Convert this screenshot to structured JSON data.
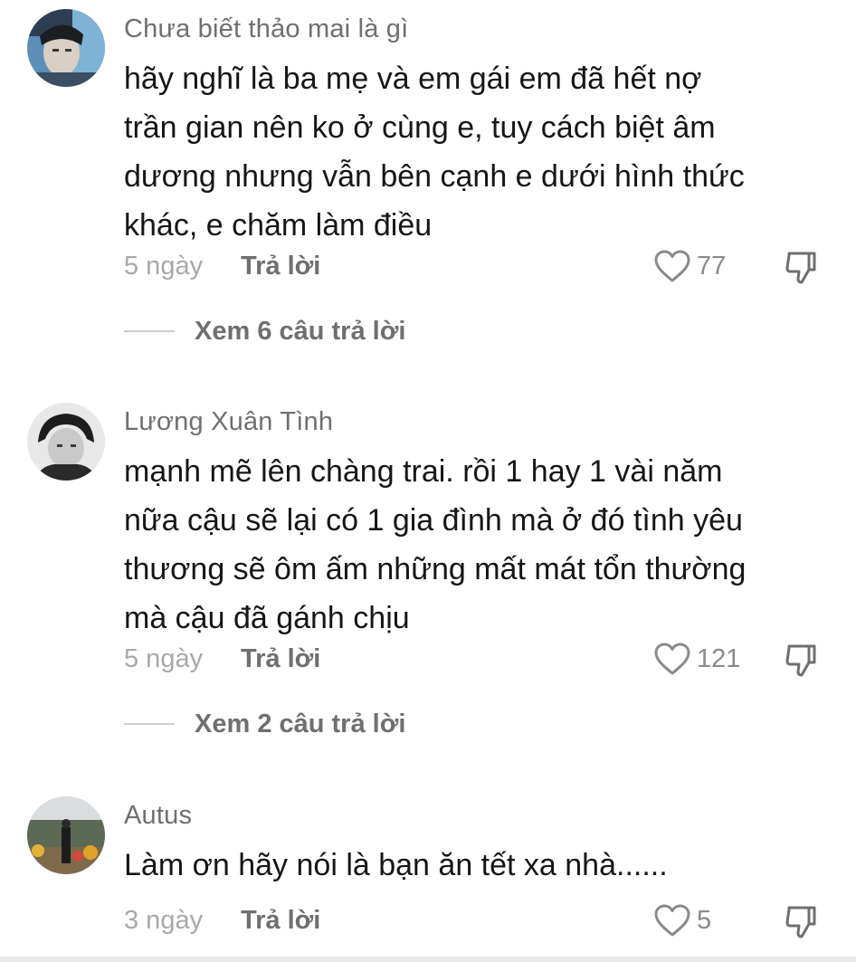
{
  "comments": [
    {
      "username": "Chưa biết thảo mai là gì",
      "lines": [
        "hãy nghĩ là ba mẹ và em gái em đã hết nợ",
        "trần gian nên ko ở cùng e, tuy cách biệt âm",
        "dương nhưng vẫn bên cạnh e dưới hình thức",
        "khác, e chăm làm điều"
      ],
      "time": "5 ngày",
      "reply_label": "Trả lời",
      "likes": "77",
      "view_replies": "Xem 6 câu trả lời"
    },
    {
      "username": "Lương Xuân Tình",
      "lines": [
        "mạnh mẽ lên chàng trai. rồi 1 hay 1 vài năm",
        "nữa cậu sẽ lại có 1 gia đình mà ở đó tình yêu",
        "thương sẽ ôm ấm những mất mát tổn thường",
        "mà cậu đã gánh chịu"
      ],
      "time": "5 ngày",
      "reply_label": "Trả lời",
      "likes": "121",
      "view_replies": "Xem 2 câu trả lời"
    },
    {
      "username": "Autus",
      "lines": [
        "Làm ơn hãy nói là bạn ăn tết xa nhà......"
      ],
      "time": "3 ngày",
      "reply_label": "Trả lời",
      "likes": "5"
    }
  ],
  "icons": {
    "like": "heart-outline-icon",
    "dislike": "thumbs-down-outline-icon"
  },
  "colors": {
    "username": "#6f6f6f",
    "body_text": "#161616",
    "timestamp": "#a8a8a8"
  }
}
